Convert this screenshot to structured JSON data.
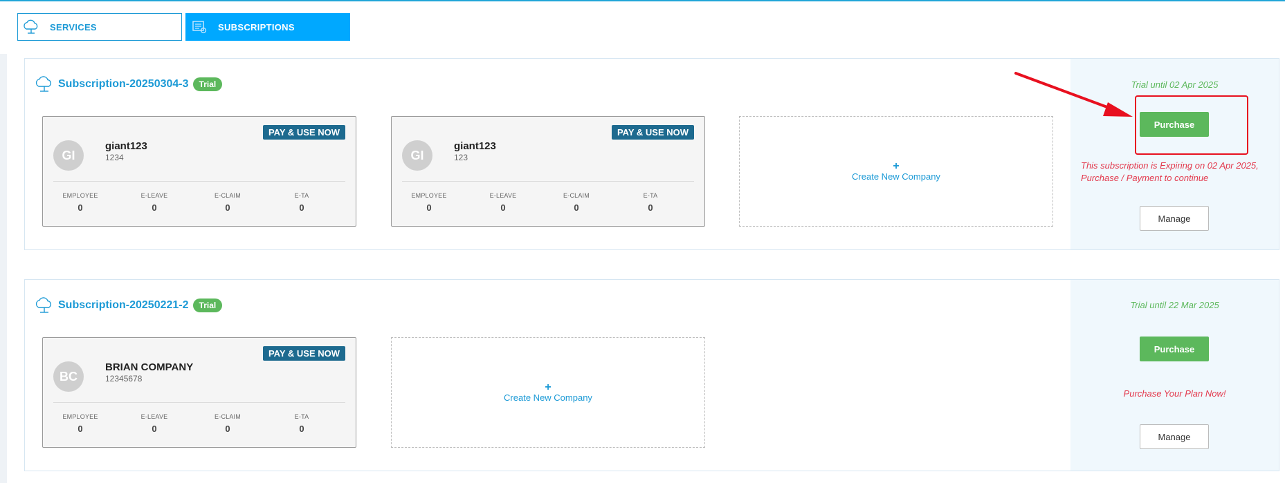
{
  "tabs": [
    {
      "label": "SERVICES",
      "icon": "cloud-icon",
      "active": false
    },
    {
      "label": "SUBSCRIPTIONS",
      "icon": "subscription-icon",
      "active": true
    }
  ],
  "subscriptions": [
    {
      "name": "Subscription-20250304-3",
      "badge": "Trial",
      "trial_until": "Trial until 02 Apr 2025",
      "purchase_label": "Purchase",
      "warning_line1": "This subscription is Expiring on 02 Apr 2025,",
      "warning_line2": "Purchase / Payment to continue",
      "manage_label": "Manage",
      "companies": [
        {
          "initials": "GI",
          "name": "giant123",
          "code": "1234",
          "pay_label": "PAY & USE NOW",
          "stats": [
            {
              "label": "EMPLOYEE",
              "value": "0"
            },
            {
              "label": "E-LEAVE",
              "value": "0"
            },
            {
              "label": "E-CLAIM",
              "value": "0"
            },
            {
              "label": "E-TA",
              "value": "0"
            }
          ]
        },
        {
          "initials": "GI",
          "name": "giant123",
          "code": "123",
          "pay_label": "PAY & USE NOW",
          "stats": [
            {
              "label": "EMPLOYEE",
              "value": "0"
            },
            {
              "label": "E-LEAVE",
              "value": "0"
            },
            {
              "label": "E-CLAIM",
              "value": "0"
            },
            {
              "label": "E-TA",
              "value": "0"
            }
          ]
        }
      ],
      "create_label": "Create New Company"
    },
    {
      "name": "Subscription-20250221-2",
      "badge": "Trial",
      "trial_until": "Trial until 22 Mar 2025",
      "purchase_label": "Purchase",
      "warning": "Purchase Your Plan Now!",
      "manage_label": "Manage",
      "companies": [
        {
          "initials": "BC",
          "name": "BRIAN COMPANY",
          "code": "12345678",
          "pay_label": "PAY & USE NOW",
          "stats": [
            {
              "label": "EMPLOYEE",
              "value": "0"
            },
            {
              "label": "E-LEAVE",
              "value": "0"
            },
            {
              "label": "E-CLAIM",
              "value": "0"
            },
            {
              "label": "E-TA",
              "value": "0"
            }
          ]
        }
      ],
      "create_label": "Create New Company"
    }
  ],
  "colors": {
    "accent": "#00a8ff",
    "link": "#1c9ad6",
    "success": "#5cb85c",
    "warning": "#e33a4e",
    "pay_button": "#1d6a8f",
    "annotation": "#e8101f"
  }
}
